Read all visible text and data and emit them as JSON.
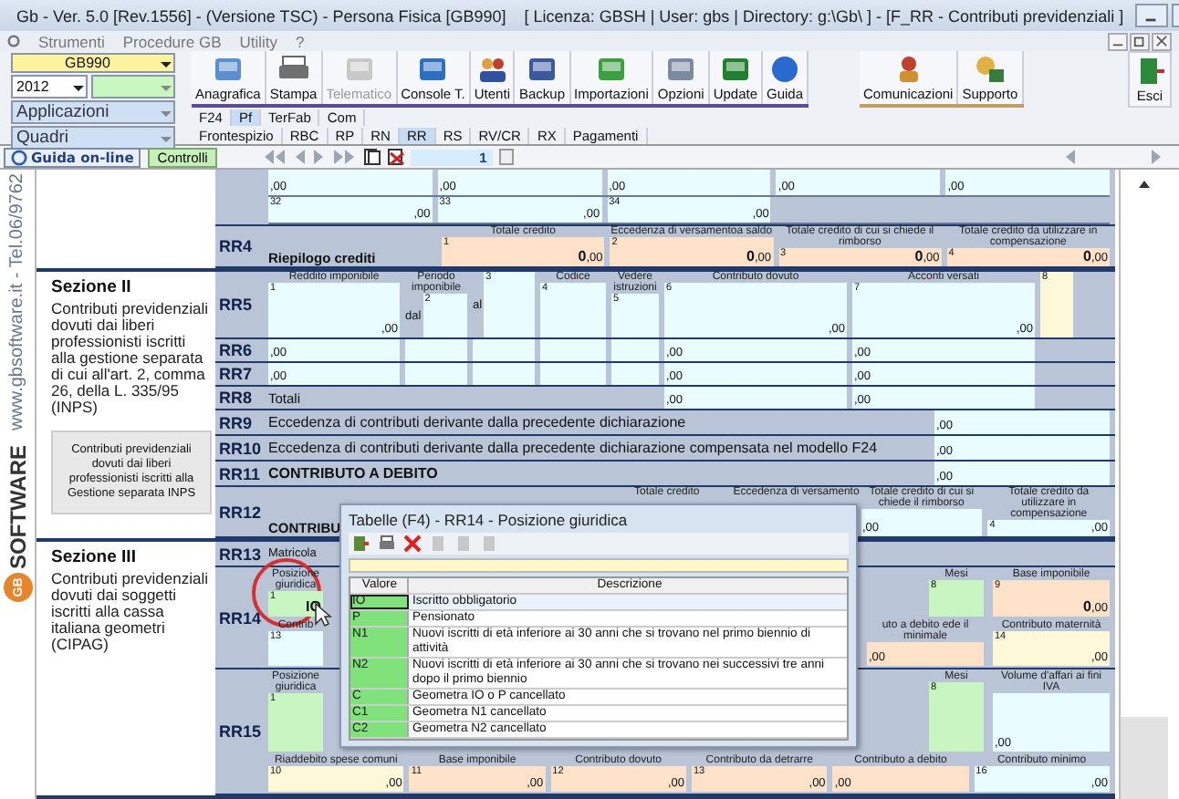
{
  "window": {
    "title": "Gb - Ver. 5.0 [Rev.1556] - (Versione TSC) -  Persona Fisica [GB990]",
    "info": "[ Licenza: GBSH | User: gbs | Directory: g:\\Gb\\ ] - [F_RR - Contributi previdenziali ]"
  },
  "menu": [
    "Strumenti",
    "Procedure GB",
    "Utility",
    "?"
  ],
  "selectors": {
    "company": "GB990",
    "year": "2012",
    "applications": "Applicazioni",
    "forms": "Quadri"
  },
  "toolbar": [
    {
      "label": "Anagrafica",
      "disabled": false
    },
    {
      "label": "Stampa",
      "disabled": false
    },
    {
      "label": "Telematico",
      "disabled": true
    },
    {
      "label": "Console T.",
      "disabled": false
    },
    {
      "label": "Utenti",
      "disabled": false
    },
    {
      "label": "Backup",
      "disabled": false
    },
    {
      "label": "Importazioni",
      "disabled": false
    },
    {
      "label": "Opzioni",
      "disabled": false
    },
    {
      "label": "Update",
      "disabled": false
    },
    {
      "label": "Guida",
      "disabled": false
    }
  ],
  "toolbar_right": [
    "Comunicazioni",
    "Supporto"
  ],
  "exit": "Esci",
  "model_tabs": [
    {
      "label": "F24",
      "selected": false
    },
    {
      "label": "Pf",
      "selected": true
    },
    {
      "label": "TerFab",
      "selected": false
    },
    {
      "label": "Com",
      "selected": false
    }
  ],
  "form_tabs": [
    {
      "label": "Frontespizio",
      "selected": false
    },
    {
      "label": "RBC",
      "selected": false
    },
    {
      "label": "RP",
      "selected": false
    },
    {
      "label": "RN",
      "selected": false
    },
    {
      "label": "RR",
      "selected": true
    },
    {
      "label": "RS",
      "selected": false
    },
    {
      "label": "RV/CR",
      "selected": false
    },
    {
      "label": "RX",
      "selected": false
    },
    {
      "label": "Pagamenti",
      "selected": false
    }
  ],
  "nav": {
    "help": "Guida on-line",
    "checks": "Controlli",
    "page": "1"
  },
  "sidebar": {
    "website": "www.gbsoftware.it - Tel.06/9762",
    "logo_mark": "GB",
    "logo": "SOFTWARE"
  },
  "groups": [
    {
      "rows": [
        {
          "kind": "carry",
          "lines": [
            [
              {
                "cents": ",00",
                "color": "#e9fcff"
              },
              {
                "cents": ",00",
                "color": "#e9fcff"
              },
              {
                "cents": ",00",
                "color": "#e9fcff"
              },
              {
                "cents": ",00",
                "color": "#e9fcff"
              },
              {
                "cents": ",00",
                "color": "#e9fcff"
              }
            ],
            [
              {
                "number": "32",
                "cents": ",00",
                "color": "#e9fcff"
              },
              {
                "number": "33",
                "cents": ",00",
                "color": "#e9fcff"
              },
              {
                "number": "34",
                "cents": ",00",
                "color": "#e9fcff"
              }
            ]
          ]
        },
        {
          "kind": "summary",
          "code": "RR4",
          "label": "Riepilogo crediti",
          "credits": [
            {
              "heading": "Totale credito",
              "number": "1",
              "value": "0",
              "cents": ",00",
              "color": "#fde2c9"
            },
            {
              "heading": "Eccedenza di versamentoa saldo",
              "number": "2",
              "value": "0",
              "cents": ",00",
              "color": "#fde2c9"
            },
            {
              "heading": "Totale credito di cui si chiede il rimborso",
              "number": "3",
              "value": "0",
              "cents": ",00",
              "color": "#fde2c9"
            },
            {
              "heading": "Totale credito da utilizzare in compensazione",
              "number": "4",
              "value": "0",
              "cents": ",00",
              "color": "#fde2c9"
            }
          ]
        }
      ]
    },
    {
      "section": {
        "title": "Sezione II",
        "text": "Contributi previdenziali dovuti dai liberi professionisti iscritti alla gestione separata di cui all'art. 2, comma 26, della L. 335/95 (INPS)",
        "note": "Contributi previdenziali dovuti dai liberi professionisti iscritti alla Gestione separata INPS"
      },
      "rows": [
        {
          "kind": "income",
          "code": "RR5",
          "cells": [
            {
              "heading": "Reddito imponibile",
              "number": "1",
              "cents": ",00",
              "color": "#e9fcff"
            },
            {
              "heading": "Periodo imponibile",
              "prefix": "dal",
              "number": "2",
              "color": "#e9fcff"
            },
            {
              "prefix": "al",
              "number": "3",
              "color": "#e9fcff"
            },
            {
              "heading": "Codice",
              "number": "4",
              "color": "#e9fcff"
            },
            {
              "heading": "Vedere istruzioni",
              "number": "5",
              "color": "#e9fcff"
            },
            {
              "heading": "Contributo dovuto",
              "number": "6",
              "cents": ",00",
              "color": "#e9fcff"
            },
            {
              "heading": "Acconti versati",
              "number": "7",
              "cents": ",00",
              "color": "#e9fcff"
            },
            {
              "number": "8",
              "color": "#fdf9d8"
            }
          ]
        },
        {
          "kind": "income",
          "code": "RR6",
          "cells": [
            {
              "cents": ",00",
              "color": "#e9fcff"
            },
            {
              "color": "#e9fcff"
            },
            {
              "color": "#e9fcff"
            },
            {
              "color": "#e9fcff"
            },
            {
              "color": "#e9fcff"
            },
            {
              "cents": ",00",
              "color": "#e9fcff"
            },
            {
              "cents": ",00",
              "color": "#e9fcff"
            }
          ]
        },
        {
          "kind": "income",
          "code": "RR7",
          "cells": [
            {
              "cents": ",00",
              "color": "#e9fcff"
            },
            {
              "color": "#e9fcff"
            },
            {
              "color": "#e9fcff"
            },
            {
              "color": "#e9fcff"
            },
            {
              "color": "#e9fcff"
            },
            {
              "cents": ",00",
              "color": "#e9fcff"
            },
            {
              "cents": ",00",
              "color": "#e9fcff"
            }
          ]
        },
        {
          "kind": "income",
          "code": "RR8",
          "label": "Totali",
          "cells": [
            "",
            "",
            "",
            "",
            "",
            {
              "cents": ",00",
              "color": "#e9fcff"
            },
            {
              "cents": ",00",
              "color": "#e9fcff"
            }
          ]
        },
        {
          "kind": "line",
          "code": "RR9",
          "label": "Eccedenza di contributi derivante dalla precedente dichiarazione",
          "cells": [
            {
              "cents": ",00",
              "color": "#e9fcff"
            }
          ]
        },
        {
          "kind": "line",
          "code": "RR10",
          "label": "Eccedenza di contributi derivante dalla precedente dichiarazione compensata nel modello  F24",
          "cells": [
            {
              "cents": ",00",
              "color": "#e9fcff"
            }
          ]
        },
        {
          "kind": "due",
          "code": "RR11",
          "label": "CONTRIBUTO A DEBITO",
          "cells": [
            {
              "cents": ",00",
              "color": "#e9fcff"
            }
          ]
        },
        {
          "kind": "summary",
          "code": "RR12",
          "label": "CONTRIBU",
          "credits": [
            {
              "heading": "Totale credito"
            },
            {
              "heading": "Eccedenza di versamento"
            },
            {
              "heading": "Totale credito di cui si chiede il rimborso",
              "cents": ",00",
              "color": "#e9fcff"
            },
            {
              "heading": "Totale credito da utilizzare in compensazione",
              "number": "4",
              "cents": ",00",
              "color": "#e9fcff"
            }
          ]
        }
      ]
    },
    {
      "section": {
        "title": "Sezione III",
        "text": "Contributi previdenziali dovuti dai soggetti iscritti alla cassa italiana geometri (CIPAG)"
      },
      "rows": [
        {
          "kind": "plain",
          "code": "RR13",
          "label": "Matricola"
        },
        {
          "kind": "position",
          "code": "RR14",
          "lines": [
            {
              "left": [
                {
                  "heading": "Posizione giuridica",
                  "number": "1",
                  "value": "IO",
                  "color": "#c9f5c3"
                }
              ],
              "right": [
                {
                  "heading": "Mesi",
                  "number": "8",
                  "color": "#c9f5c3"
                },
                {
                  "heading": "Base imponibile",
                  "number": "9",
                  "value": "0",
                  "cents": ",00",
                  "color": "#fde2c9"
                }
              ]
            },
            {
              "left": [
                {
                  "heading": "Contrib",
                  "number": "13",
                  "color": "#e9fcff"
                }
              ],
              "right": [
                {
                  "heading": "uto a debito ede il minimale",
                  "cents": ",00",
                  "color": "#fde2c9"
                },
                {
                  "heading": "Contributo maternità",
                  "number": "14",
                  "cents": ",00",
                  "color": "#fdf9d8"
                }
              ]
            }
          ]
        },
        {
          "kind": "position",
          "code": "RR15",
          "lines": [
            {
              "left": [
                {
                  "heading": "Posizione giuridica",
                  "number": "1",
                  "color": "#c9f5c3"
                }
              ],
              "right": [
                {
                  "heading": "Mesi",
                  "number": "8",
                  "color": "#c9f5c3"
                },
                {
                  "heading": "Volume d'affari ai fini IVA",
                  "cents": ",00",
                  "color": "#e9fcff"
                }
              ]
            },
            {
              "cells": [
                {
                  "heading": "Riaddebito spese comuni",
                  "number": "10",
                  "cents": ",00",
                  "color": "#fdf9d8"
                },
                {
                  "heading": "Base imponibile",
                  "number": "11",
                  "cents": ",00",
                  "color": "#fde2c9"
                },
                {
                  "heading": "Contributo dovuto",
                  "number": "12",
                  "cents": ",00",
                  "color": "#fde2c9"
                },
                {
                  "heading": "Contributo da detrarre",
                  "number": "13",
                  "cents": ",00",
                  "color": "#fde2c9"
                },
                {
                  "heading": "Contributo a debito",
                  "cents": ",00",
                  "color": "#fde2c9"
                },
                {
                  "heading": "Contributo minimo",
                  "number": "16",
                  "cents": ",00",
                  "color": "#e9fcff"
                }
              ]
            }
          ]
        }
      ]
    }
  ],
  "dialog": {
    "title": "Tabelle (F4) - RR14 - Posizione giuridica",
    "columns": [
      "Valore",
      "Descrizione"
    ],
    "rows": [
      {
        "value": "IO",
        "description": "Iscritto obbligatorio",
        "selected": true
      },
      {
        "value": "P",
        "description": "Pensionato",
        "selected": false
      },
      {
        "value": "N1",
        "description": "Nuovi iscritti di età inferiore ai 30 anni che si trovano nel primo biennio di attività",
        "selected": false
      },
      {
        "value": "N2",
        "description": "Nuovi iscritti di età inferiore ai 30 anni che si trovano nei successivi tre anni dopo il primo biennio",
        "selected": false
      },
      {
        "value": "C",
        "description": "Geometra IO o P cancellato",
        "selected": false
      },
      {
        "value": "C1",
        "description": "Geometra N1 cancellato",
        "selected": false
      },
      {
        "value": "C2",
        "description": "Geometra N2 cancellato",
        "selected": false
      }
    ]
  }
}
